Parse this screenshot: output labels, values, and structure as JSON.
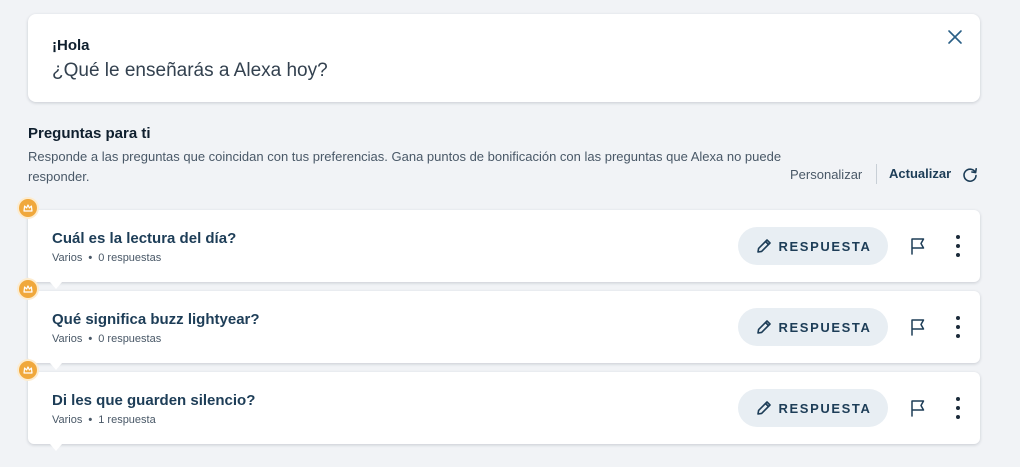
{
  "greeting": {
    "title": "¡Hola",
    "subtitle": "¿Qué le enseñarás a Alexa hoy?"
  },
  "section": {
    "title": "Preguntas para ti",
    "description": "Responde a las preguntas que coincidan con tus preferencias. Gana puntos de bonificación con las preguntas que Alexa no puede responder.",
    "personalize_label": "Personalizar",
    "refresh_label": "Actualizar"
  },
  "questions": [
    {
      "title": "Cuál es la lectura del día?",
      "category": "Varios",
      "answers": "0 respuestas",
      "answer_button": "RESPUESTA"
    },
    {
      "title": "Qué significa buzz lightyear?",
      "category": "Varios",
      "answers": "0 respuestas",
      "answer_button": "RESPUESTA"
    },
    {
      "title": "Di les que guarden silencio?",
      "category": "Varios",
      "answers": "1 respuesta",
      "answer_button": "RESPUESTA"
    }
  ],
  "colors": {
    "background": "#f1f3f6",
    "primary_text": "#1d3d57",
    "badge": "#f0a83c",
    "answer_button_bg": "#e8eef3"
  },
  "icons": {
    "close": "close-icon",
    "refresh": "refresh-icon",
    "badge": "crown-badge-icon",
    "pencil": "pencil-icon",
    "flag": "flag-icon",
    "more": "more-vertical-icon"
  }
}
